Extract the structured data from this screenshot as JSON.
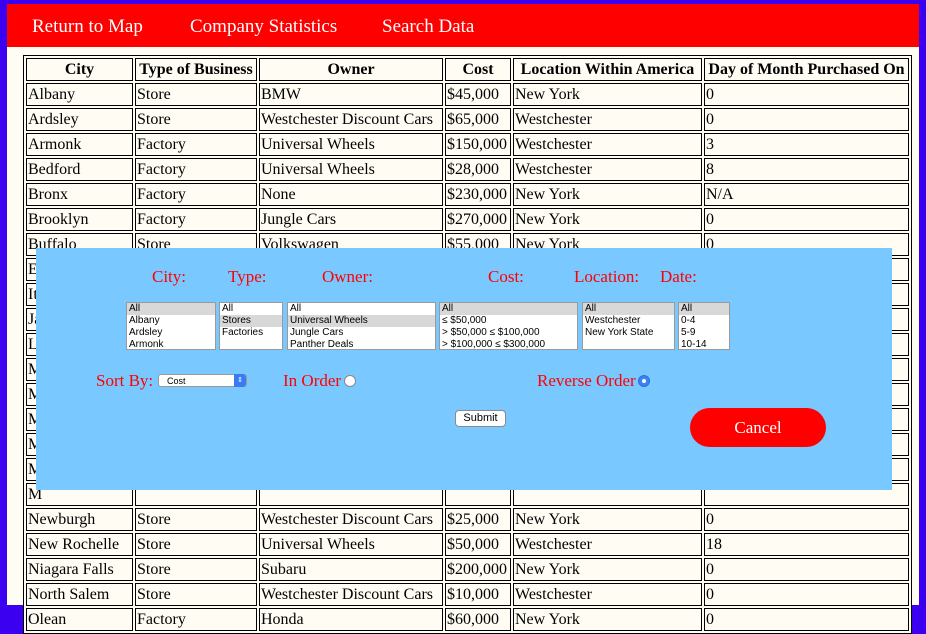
{
  "nav": {
    "return_map": "Return to Map",
    "company_stats": "Company Statistics",
    "search_data": "Search Data"
  },
  "table": {
    "headers": [
      "City",
      "Type of Business",
      "Owner",
      "Cost",
      "Location Within America",
      "Day of Month Purchased On"
    ],
    "rows": [
      [
        "Albany",
        "Store",
        "BMW",
        "$45,000",
        "New York",
        "0"
      ],
      [
        "Ardsley",
        "Store",
        "Westchester Discount Cars",
        "$65,000",
        "Westchester",
        "0"
      ],
      [
        "Armonk",
        "Factory",
        "Universal Wheels",
        "$150,000",
        "Westchester",
        "3"
      ],
      [
        "Bedford",
        "Factory",
        "Universal Wheels",
        "$28,000",
        "Westchester",
        "8"
      ],
      [
        "Bronx",
        "Factory",
        "None",
        "$230,000",
        "New York",
        "N/A"
      ],
      [
        "Brooklyn",
        "Factory",
        "Jungle Cars",
        "$270,000",
        "New York",
        "0"
      ],
      [
        "Buffalo",
        "Store",
        "Volkswagen",
        "$55,000",
        "New York",
        "0"
      ],
      [
        "E",
        "",
        "",
        "",
        "",
        ""
      ],
      [
        "It",
        "",
        "",
        "",
        "",
        ""
      ],
      [
        "Ja",
        "",
        "",
        "",
        "",
        ""
      ],
      [
        "L",
        "",
        "",
        "",
        "",
        ""
      ],
      [
        "M",
        "",
        "",
        "",
        "",
        ""
      ],
      [
        "M",
        "",
        "",
        "",
        "",
        ""
      ],
      [
        "M",
        "",
        "",
        "",
        "",
        ""
      ],
      [
        "M",
        "",
        "",
        "",
        "",
        ""
      ],
      [
        "M",
        "",
        "",
        "",
        "",
        ""
      ],
      [
        "M",
        "",
        "",
        "",
        "",
        ""
      ],
      [
        "Newburgh",
        "Store",
        "Westchester Discount Cars",
        "$25,000",
        "New York",
        "0"
      ],
      [
        "New Rochelle",
        "Store",
        "Universal Wheels",
        "$50,000",
        "Westchester",
        "18"
      ],
      [
        "Niagara Falls",
        "Store",
        "Subaru",
        "$200,000",
        "New York",
        "0"
      ],
      [
        "North Salem",
        "Store",
        "Westchester Discount Cars",
        "$10,000",
        "Westchester",
        "0"
      ],
      [
        "Olean",
        "Factory",
        "Honda",
        "$60,000",
        "New York",
        "0"
      ]
    ]
  },
  "filter": {
    "city_label": "City:",
    "type_label": "Type:",
    "owner_label": "Owner:",
    "cost_label": "Cost:",
    "location_label": "Location:",
    "date_label": "Date:",
    "city_options": [
      "All",
      "Albany",
      "Ardsley",
      "Armonk"
    ],
    "type_options": [
      "All",
      "Stores",
      "Factories"
    ],
    "owner_options": [
      "All",
      "Universal Wheels",
      "Jungle Cars",
      "Panther Deals"
    ],
    "cost_options": [
      "All",
      "≤ $50,000",
      "> $50,000 ≤ $100,000",
      "> $100,000 ≤ $300,000"
    ],
    "location_options": [
      "All",
      "Westchester",
      "New York State"
    ],
    "date_options": [
      "All",
      "0-4",
      "5-9",
      "10-14"
    ],
    "sort_label": "Sort By:",
    "sort_value": "Cost",
    "in_order_label": "In Order",
    "reverse_label": "Reverse Order",
    "submit_label": "Submit",
    "cancel_label": "Cancel"
  }
}
